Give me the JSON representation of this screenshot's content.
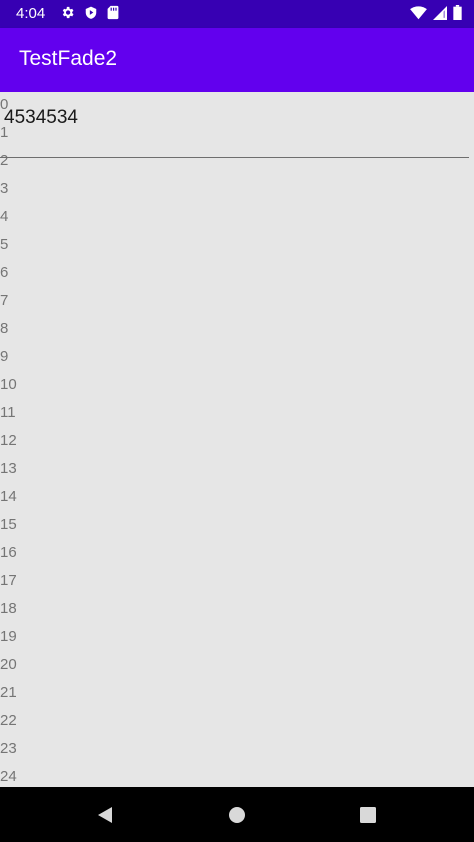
{
  "status_bar": {
    "time": "4:04",
    "left_icons": [
      "gear-icon",
      "play-protect-icon",
      "sd-card-icon"
    ],
    "right_icons": [
      "wifi-icon",
      "signal-icon",
      "battery-icon"
    ],
    "color": "#3700b3"
  },
  "app_bar": {
    "title": "TestFade2",
    "color": "#6200ee"
  },
  "content": {
    "overlay_text": "4534534",
    "rows": [
      "0",
      "1",
      "2",
      "3",
      "4",
      "5",
      "6",
      "7",
      "8",
      "9",
      "10",
      "11",
      "12",
      "13",
      "14",
      "15",
      "16",
      "17",
      "18",
      "19",
      "20",
      "21",
      "22",
      "23",
      "24"
    ]
  },
  "nav_bar": {
    "buttons": [
      "back-icon",
      "home-icon",
      "recents-icon"
    ]
  }
}
